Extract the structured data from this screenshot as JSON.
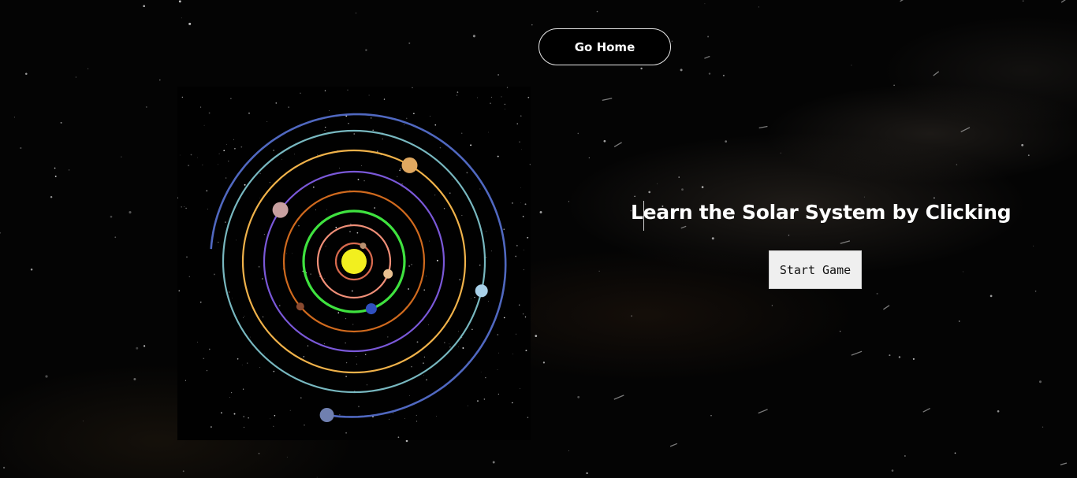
{
  "nav": {
    "home_label": "Go Home"
  },
  "hero": {
    "title": "Learn the Solar System by Clicking",
    "start_label": "Start Game"
  },
  "colors": {
    "background": "#040404",
    "sun": "#f2ef1f",
    "orbit_mercury": "#d86a4e",
    "orbit_venus": "#f08f78",
    "orbit_earth": "#3fe23f",
    "orbit_mars": "#d06a1e",
    "orbit_jupiter": "#7a58d8",
    "orbit_saturn": "#f0b24a",
    "orbit_uranus": "#78b8c0",
    "orbit_neptune": "#5068c0"
  },
  "solar_model": {
    "planets": [
      {
        "name": "mercury",
        "orbit_color": "#d86a4e",
        "body_color": "#b89070",
        "angle_deg": 300
      },
      {
        "name": "venus",
        "orbit_color": "#f08f78",
        "body_color": "#e8c090",
        "angle_deg": 20
      },
      {
        "name": "earth",
        "orbit_color": "#3fe23f",
        "body_color": "#3050c0",
        "angle_deg": 70
      },
      {
        "name": "mars",
        "orbit_color": "#d06a1e",
        "body_color": "#8a4a30",
        "angle_deg": 140
      },
      {
        "name": "jupiter",
        "orbit_color": "#7a58d8",
        "body_color": "#c8a0a0",
        "angle_deg": 215
      },
      {
        "name": "saturn",
        "orbit_color": "#f0b24a",
        "body_color": "#e0a860",
        "angle_deg": 300
      },
      {
        "name": "uranus",
        "orbit_color": "#78b8c0",
        "body_color": "#a8d0e8",
        "angle_deg": 13
      },
      {
        "name": "neptune",
        "orbit_color": "#5068c0",
        "body_color": "#7080b0",
        "angle_deg": 100
      }
    ]
  }
}
